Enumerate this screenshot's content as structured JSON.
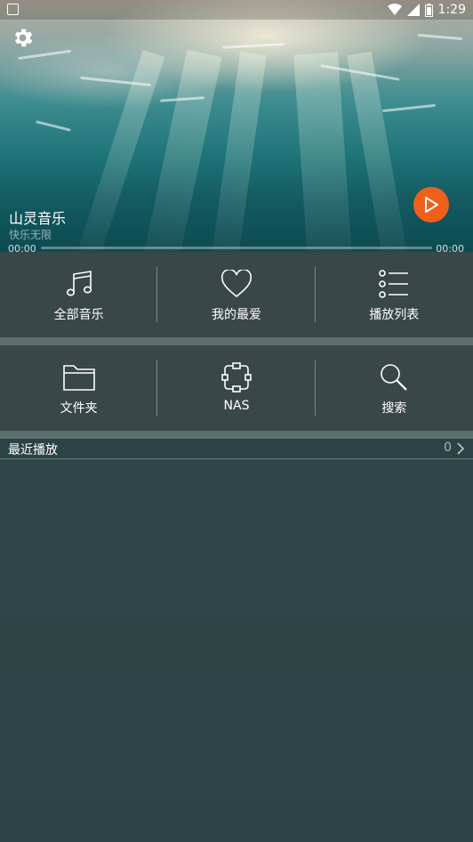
{
  "status_bar": {
    "time": "1:29"
  },
  "player": {
    "title": "山灵音乐",
    "subtitle": "快乐无限",
    "time_current": "00:00",
    "time_total": "00:00",
    "progress": 0
  },
  "menu": {
    "row1": [
      {
        "label": "全部音乐",
        "icon": "music-note-icon"
      },
      {
        "label": "我的最爱",
        "icon": "heart-icon"
      },
      {
        "label": "播放列表",
        "icon": "playlist-icon"
      }
    ],
    "row2": [
      {
        "label": "文件夹",
        "icon": "folder-icon"
      },
      {
        "label": "NAS",
        "icon": "nas-icon"
      },
      {
        "label": "搜索",
        "icon": "search-icon"
      }
    ]
  },
  "recent": {
    "title": "最近播放",
    "count": "0"
  },
  "colors": {
    "accent": "#f0601a",
    "panel": "#3c4848",
    "background": "#2c4345"
  }
}
